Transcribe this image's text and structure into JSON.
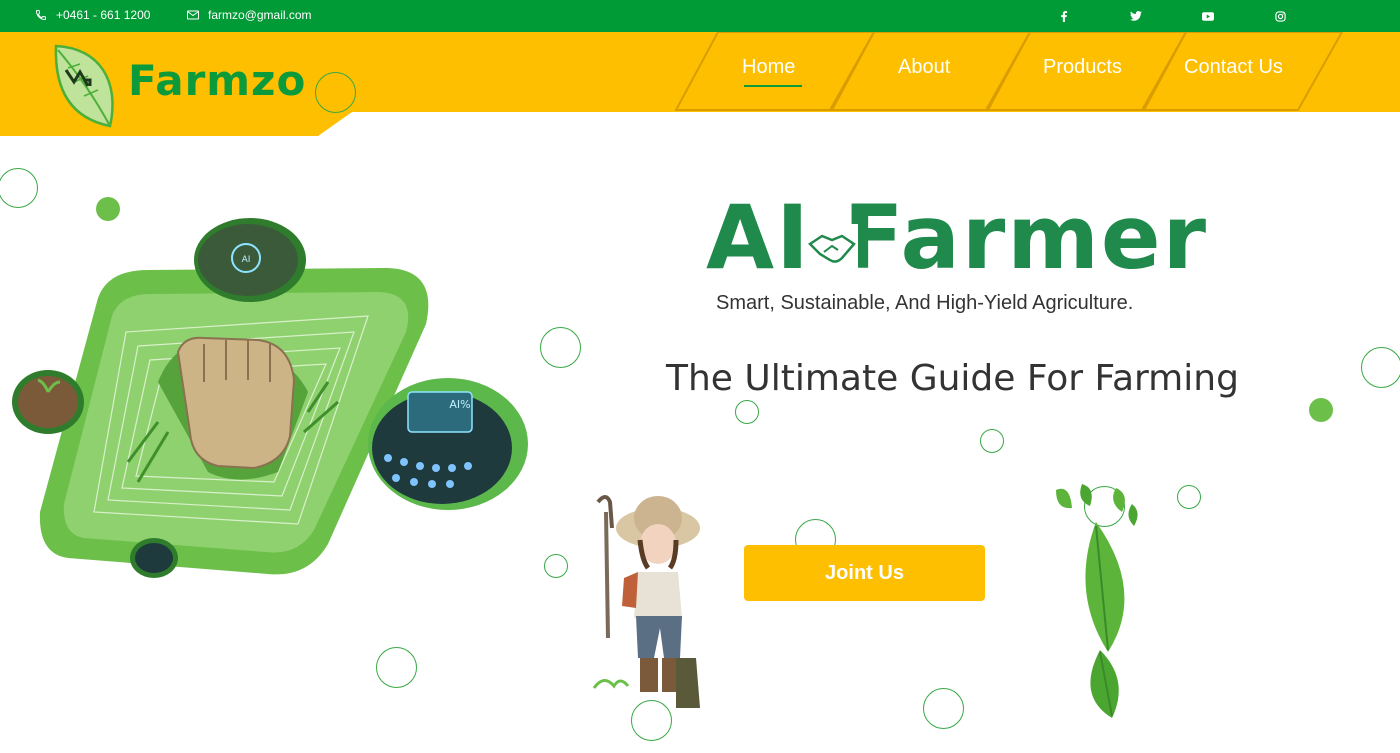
{
  "topbar": {
    "phone": "+0461 - 661 1200",
    "email": "farmzo@gmail.com",
    "social": [
      "facebook-icon",
      "twitter-icon",
      "youtube-icon",
      "instagram-icon"
    ]
  },
  "brand": {
    "name": "Farmzo"
  },
  "nav": {
    "items": [
      {
        "label": "Home",
        "active": true
      },
      {
        "label": "About"
      },
      {
        "label": "Products"
      },
      {
        "label": "Contact Us"
      }
    ]
  },
  "hero": {
    "title": "AI Farmer",
    "tagline": "Smart, Sustainable, And High-Yield Agriculture.",
    "headline": "The Ultimate Guide For Farming",
    "cta_label": "Joint Us"
  },
  "colors": {
    "topbar": "#009a36",
    "header": "#fdbf00",
    "brand_green": "#0d9a3a",
    "accent_green": "#6cc04a"
  }
}
